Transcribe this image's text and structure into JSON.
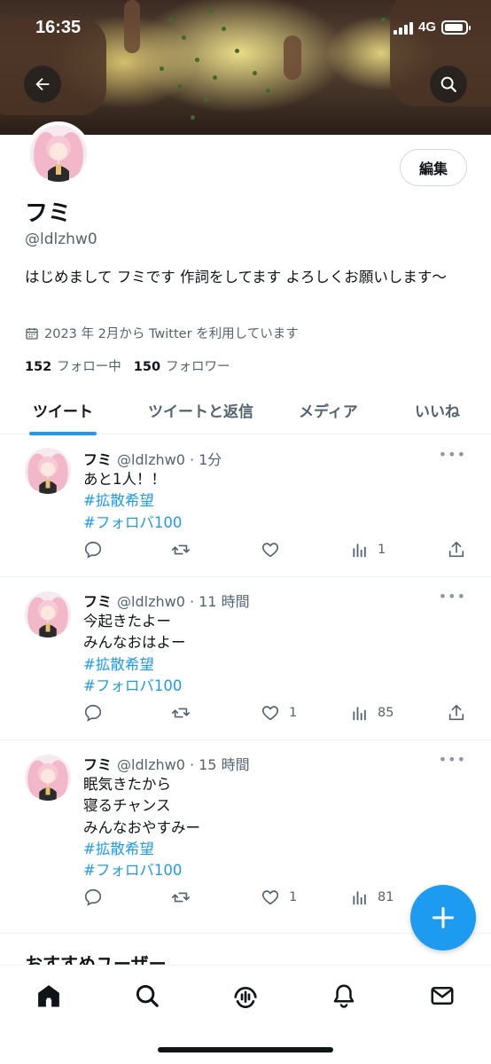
{
  "status_bar": {
    "time": "16:35",
    "network": "4G",
    "battery_level": 0.9
  },
  "header": {
    "back_icon": "arrow-left-icon",
    "search_icon": "search-icon"
  },
  "profile": {
    "edit_label": "編集",
    "name": "フミ",
    "handle": "@ldlzhw0",
    "bio": "はじめまして フミです 作詞をしてます よろしくお願いします〜",
    "joined": "2023 年 2月から Twitter を利用しています",
    "following_count": "152",
    "following_label": "フォロー中",
    "followers_count": "150",
    "followers_label": "フォロワー"
  },
  "tabs": [
    {
      "label": "ツイート",
      "active": true
    },
    {
      "label": "ツイートと返信",
      "active": false
    },
    {
      "label": "メディア",
      "active": false
    },
    {
      "label": "いいね",
      "active": false
    }
  ],
  "tweets": [
    {
      "name": "フミ",
      "meta": "@ldlzhw0 · 1分",
      "lines": [
        "あと1人！！"
      ],
      "hashtags": [
        "#拡散希望",
        "#フォロバ100"
      ],
      "likes": "",
      "views": "1"
    },
    {
      "name": "フミ",
      "meta": "@ldlzhw0 · 11 時間",
      "lines": [
        "今起きたよー",
        "みんなおはよー"
      ],
      "hashtags": [
        "#拡散希望",
        "#フォロバ100"
      ],
      "likes": "1",
      "views": "85"
    },
    {
      "name": "フミ",
      "meta": "@ldlzhw0 · 15 時間",
      "lines": [
        "眠気きたから",
        "寝るチャンス",
        "みんなおやすみー"
      ],
      "hashtags": [
        "#拡散希望",
        "#フォロバ100"
      ],
      "likes": "1",
      "views": "81"
    }
  ],
  "section_peek": "おすすめユーザー",
  "fab_icon": "plus-icon",
  "bottom_nav": [
    "home-icon",
    "search-icon",
    "spaces-icon",
    "notifications-icon",
    "messages-icon"
  ],
  "colors": {
    "accent": "#1d9bf0",
    "text": "#0f1419",
    "muted": "#536471"
  }
}
